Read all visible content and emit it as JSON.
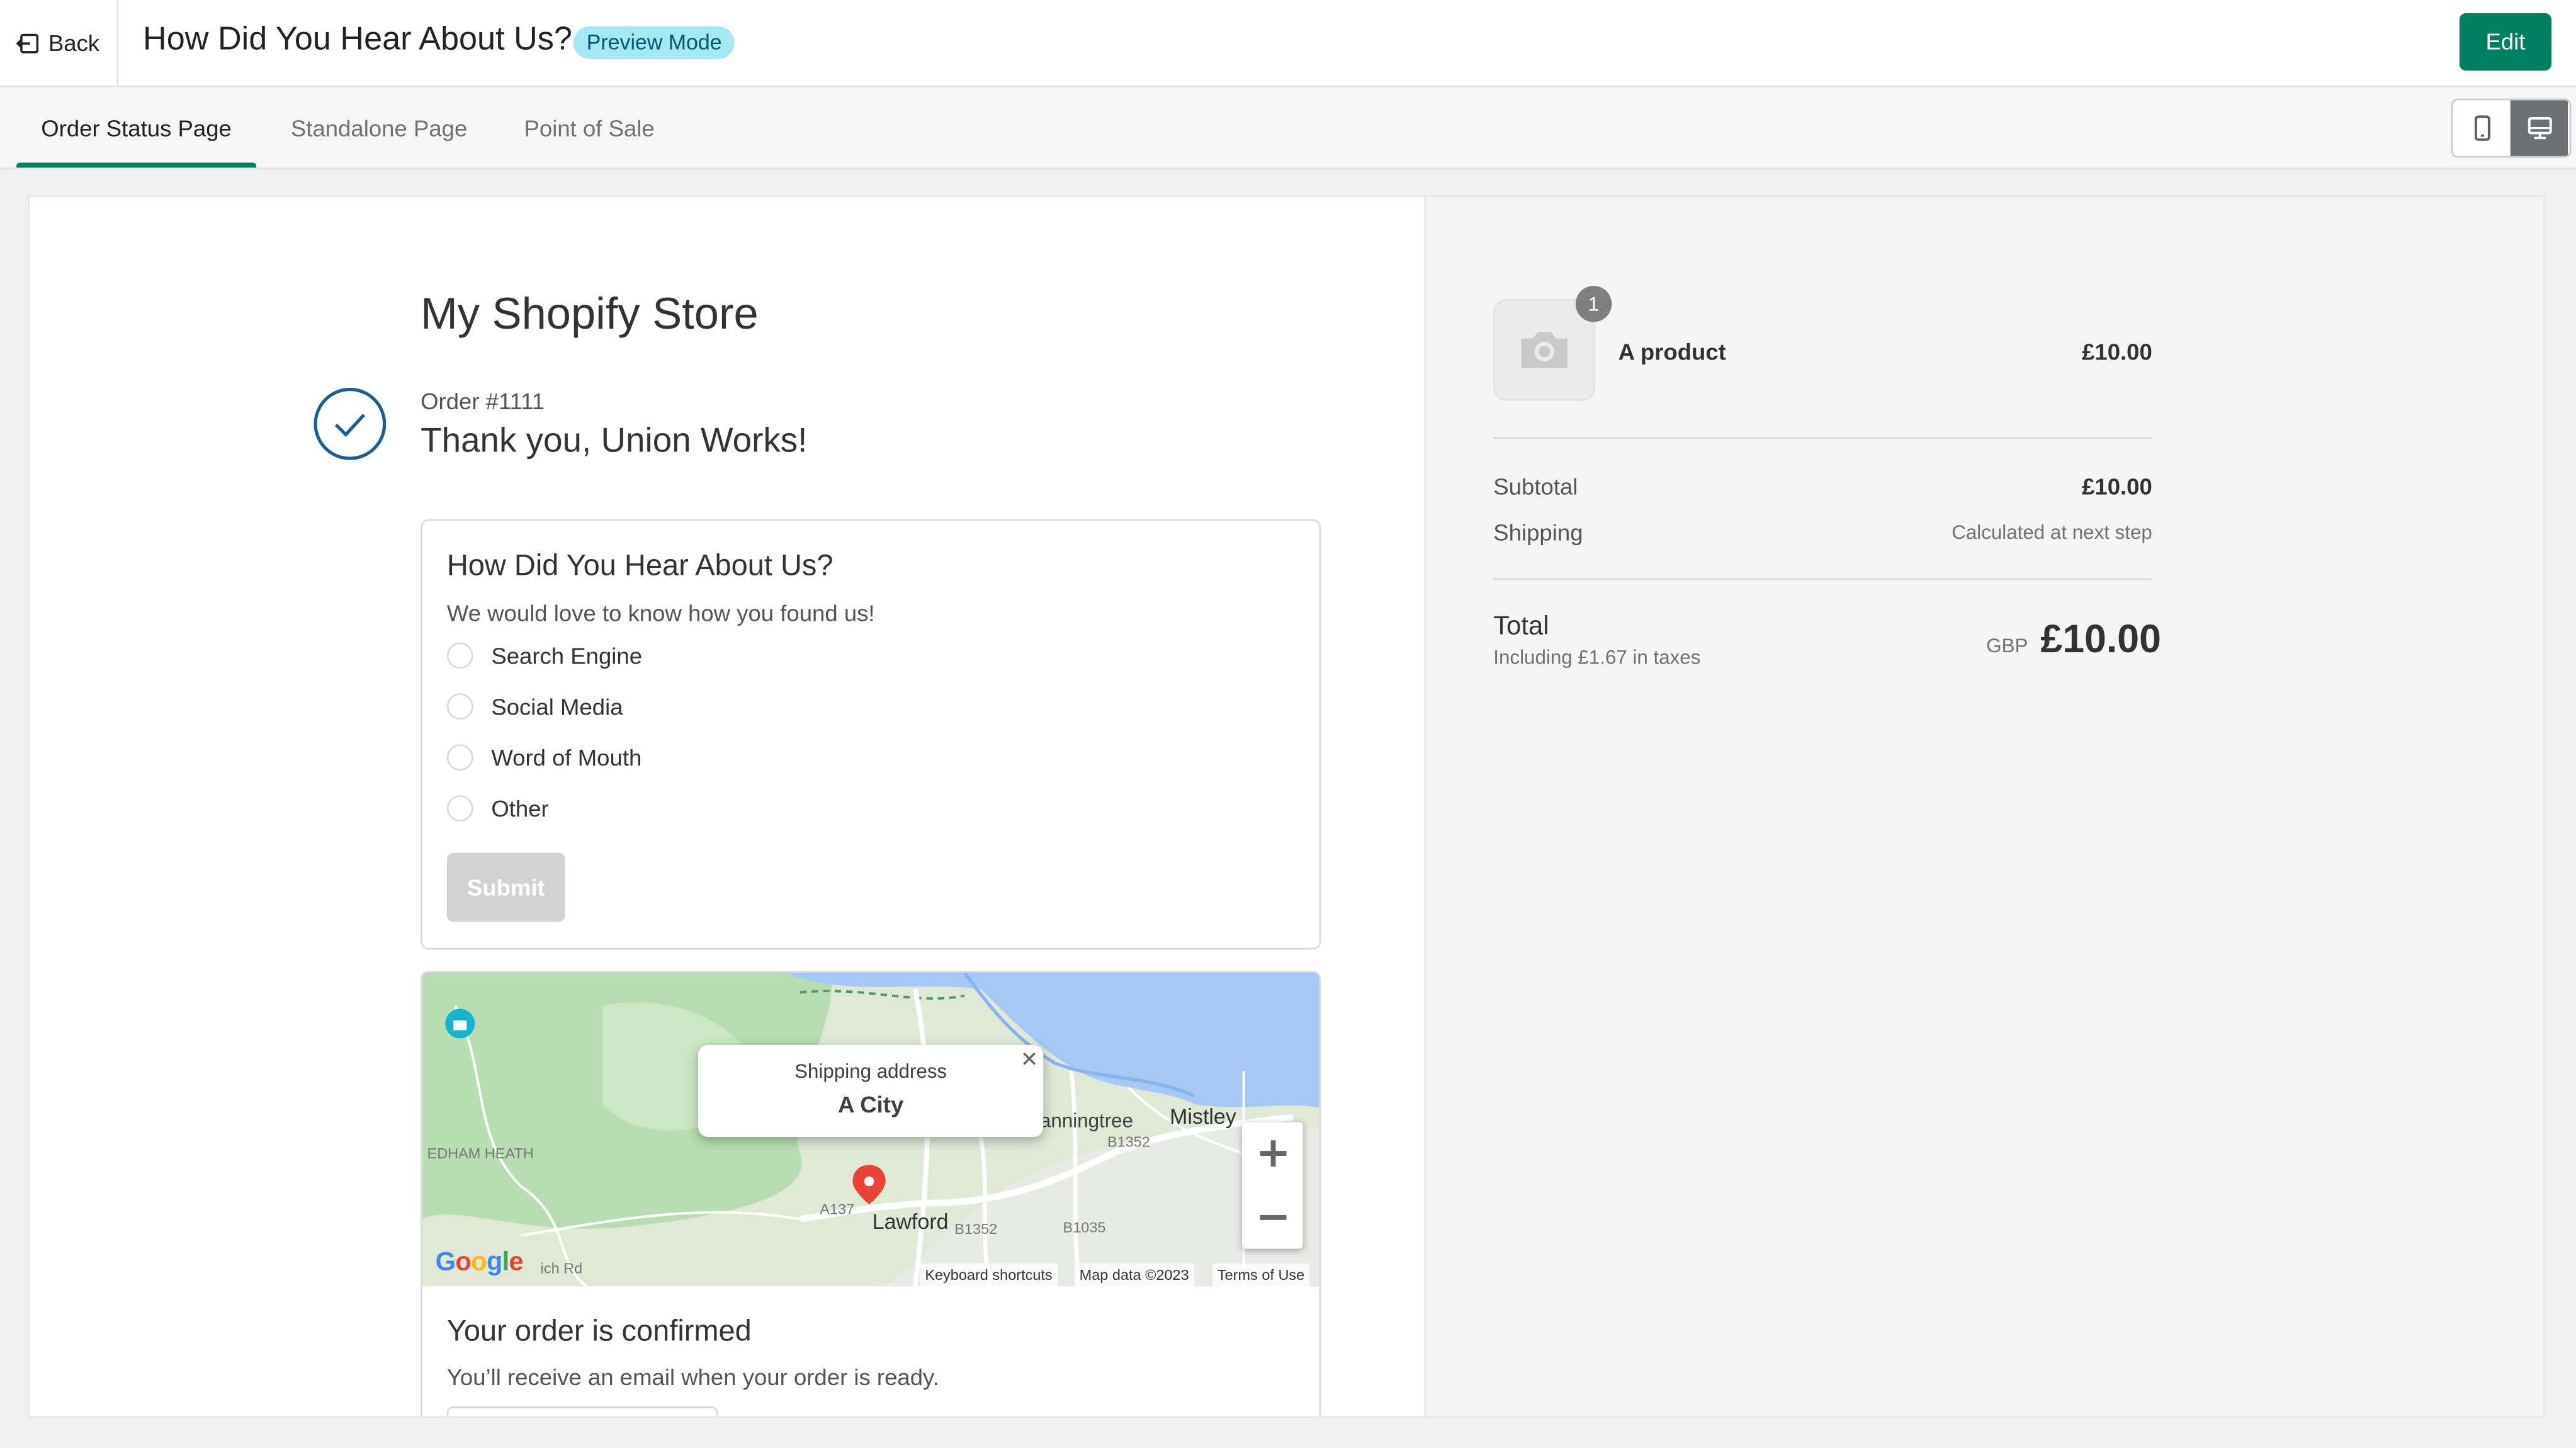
{
  "topbar": {
    "back_label": "Back",
    "title": "How Did You Hear About Us?",
    "badge": "Preview Mode",
    "edit_label": "Edit"
  },
  "tabs": [
    {
      "label": "Order Status Page",
      "active": true
    },
    {
      "label": "Standalone Page",
      "active": false
    },
    {
      "label": "Point of Sale",
      "active": false
    }
  ],
  "view_toggle": {
    "options": [
      "mobile-icon",
      "desktop-icon"
    ],
    "selected": "desktop"
  },
  "colors": {
    "accent": "#008060",
    "badge_bg": "#a4e8f2",
    "badge_text": "#00586b",
    "check": "#1f5e8c"
  },
  "order": {
    "store_name": "My Shopify Store",
    "order_number": "Order #1111",
    "thank_you": "Thank you, Union Works!"
  },
  "survey": {
    "title": "How Did You Hear About Us?",
    "subtitle": "We would love to know how you found us!",
    "options": [
      "Search Engine",
      "Social Media",
      "Word of Mouth",
      "Other"
    ],
    "submit_label": "Submit"
  },
  "map": {
    "popup_label": "Shipping address",
    "popup_city": "A City",
    "places": [
      "Lawford",
      "Mistley",
      "anningtree",
      "EDHAM HEATH"
    ],
    "roads": [
      "A137",
      "B1352",
      "B1352",
      "B1035",
      "B1352",
      "ich Rd"
    ],
    "provider": "Google",
    "attribution": [
      "Keyboard shortcuts",
      "Map data ©2023",
      "Terms of Use"
    ]
  },
  "confirmation": {
    "title": "Your order is confirmed",
    "subtitle": "You’ll receive an email when your order is ready."
  },
  "summary": {
    "product_name": "A product",
    "quantity": "1",
    "product_price": "£10.00",
    "subtotal_label": "Subtotal",
    "subtotal_value": "£10.00",
    "shipping_label": "Shipping",
    "shipping_value": "Calculated at next step",
    "total_label": "Total",
    "tax_note": "Including £1.67 in taxes",
    "currency": "GBP",
    "total_value": "£10.00"
  }
}
